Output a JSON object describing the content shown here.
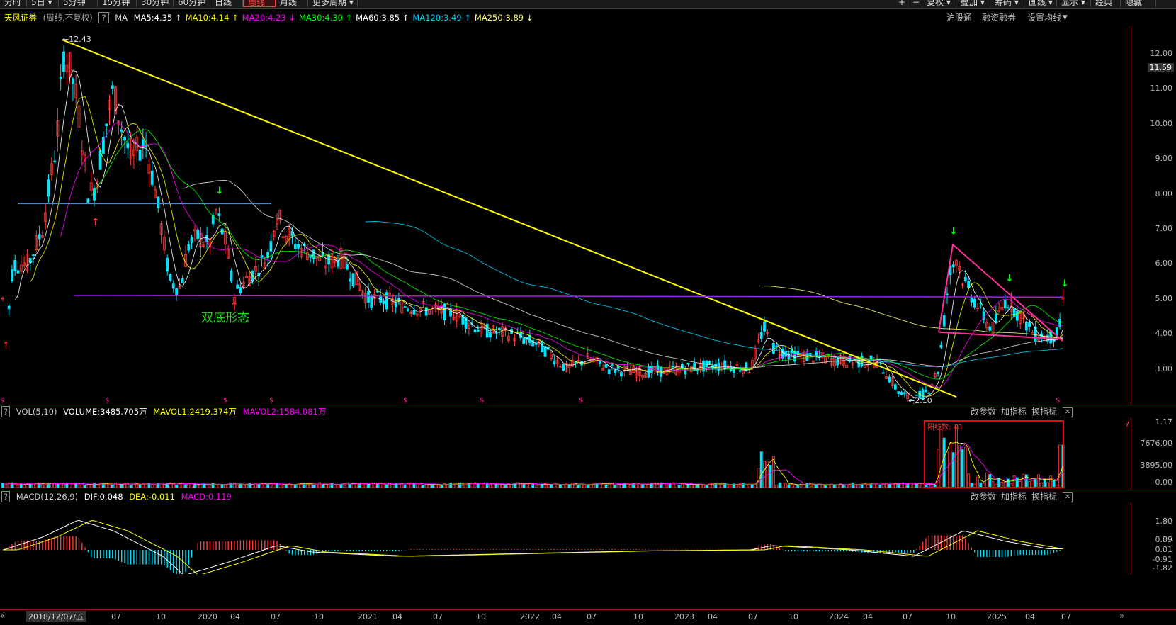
{
  "toolbar": {
    "left_tabs": [
      "分时",
      "5日",
      "5分钟",
      "15分钟",
      "30分钟",
      "60分钟",
      "日线",
      "周线",
      "月线",
      "更多周期"
    ],
    "active_tab": "周线",
    "right_buttons": [
      "复权",
      "叠加",
      "筹码",
      "画线",
      "显示",
      "经典",
      "隐藏"
    ]
  },
  "header": {
    "stock_name": "天风证券",
    "mode": "(周线,不复权)",
    "help": "?",
    "ma_label": "MA",
    "ma": [
      {
        "text": "MA5:4.35",
        "color": "#ffffff"
      },
      {
        "text": "MA10:4.14",
        "color": "#ffff00"
      },
      {
        "text": "MA20:4.23",
        "color": "#ff00ff"
      },
      {
        "text": "MA30:4.30",
        "color": "#00ff00"
      },
      {
        "text": "MA60:3.85",
        "color": "#ffffff"
      },
      {
        "text": "MA120:3.49",
        "color": "#00d0ff"
      },
      {
        "text": "MA250:3.89",
        "color": "#ffff66"
      }
    ],
    "right_links": [
      "沪股通",
      "融资融券",
      "设置均线"
    ]
  },
  "main_axis": {
    "labels": [
      "12.00",
      "11.00",
      "10.00",
      "9.00",
      "8.00",
      "7.00",
      "6.00",
      "5.00",
      "4.00",
      "3.00"
    ],
    "current_price": "11.59"
  },
  "annotations": {
    "high_label": "12.43",
    "low_label": "2.10",
    "pattern_text": "双底形态",
    "dollar_marker": "$"
  },
  "volume_pane": {
    "title": "VOL(5,10)",
    "volume": "VOLUME:3485.705万",
    "mavol1": "MAVOL1:2419.374万",
    "mavol2": "MAVOL2:1584.081万",
    "axis": [
      "1.17",
      "7676.00",
      "3895.00",
      "0.00"
    ],
    "box_label": "阳线数: 48",
    "side_label": "7"
  },
  "macd_pane": {
    "title": "MACD(12,26,9)",
    "dif": "DIF:0.048",
    "dea": "DEA:-0.011",
    "macd": "MACD:0.119",
    "axis": [
      "1.80",
      "0.89",
      "0.01",
      "-0.91",
      "-1.82"
    ]
  },
  "pane_buttons": [
    "改参数",
    "加指标",
    "换指标"
  ],
  "x_axis": {
    "cursor_date": "2018/12/07/五",
    "labels": [
      "07",
      "10",
      "2020",
      "04",
      "07",
      "10",
      "2021",
      "04",
      "07",
      "10",
      "2022",
      "04",
      "07",
      "10",
      "2023",
      "04",
      "07",
      "10",
      "2024",
      "04",
      "07",
      "10",
      "2025",
      "04",
      "07"
    ]
  },
  "colors": {
    "up": "#ff3b3b",
    "down": "#00e5ff",
    "trend_yellow": "#ffff00",
    "support_purple": "#a020f0",
    "resistance_blue": "#2f8cff",
    "triangle_pink": "#ff2f9a"
  }
}
